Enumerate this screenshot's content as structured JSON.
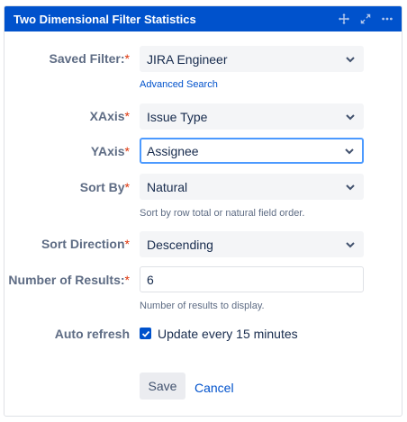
{
  "gadget": {
    "title": "Two Dimensional Filter Statistics",
    "header_icons": [
      "move-icon",
      "expand-icon",
      "more-icon"
    ]
  },
  "form": {
    "saved_filter": {
      "label": "Saved Filter:",
      "value": "JIRA Engineer",
      "link": "Advanced Search"
    },
    "xaxis": {
      "label": "XAxis",
      "value": "Issue Type"
    },
    "yaxis": {
      "label": "YAxis",
      "value": "Assignee"
    },
    "sort_by": {
      "label": "Sort By",
      "value": "Natural",
      "hint": "Sort by row total or natural field order."
    },
    "sort_direction": {
      "label": "Sort Direction",
      "value": "Descending"
    },
    "number_of_results": {
      "label": "Number of Results:",
      "value": "6",
      "hint": "Number of results to display."
    },
    "auto_refresh": {
      "label": "Auto refresh",
      "checkbox_label": "Update every 15 minutes",
      "checked": true
    },
    "required_marker": "*"
  },
  "actions": {
    "save": "Save",
    "cancel": "Cancel"
  },
  "colors": {
    "header_bg": "#0052cc",
    "focus_border": "#4c9aff",
    "required": "#de350b",
    "link": "#0052cc"
  }
}
